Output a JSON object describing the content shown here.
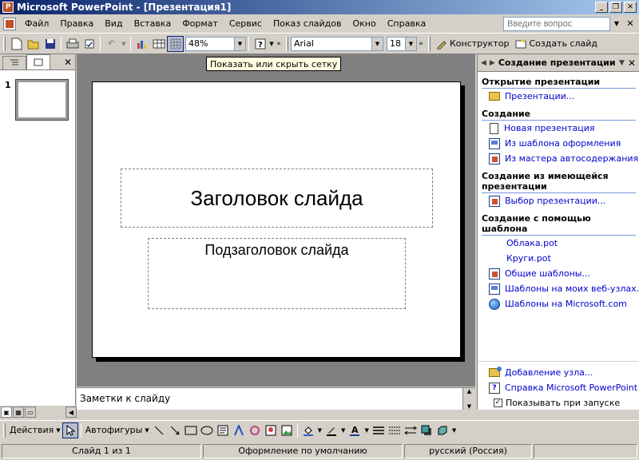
{
  "window": {
    "title": "Microsoft PowerPoint - [Презентация1]",
    "minimize": "_",
    "restore": "❐",
    "close": "✕"
  },
  "menu": {
    "items": [
      "Файл",
      "Правка",
      "Вид",
      "Вставка",
      "Формат",
      "Сервис",
      "Показ слайдов",
      "Окно",
      "Справка"
    ],
    "ask_placeholder": "Введите вопрос",
    "doc_close": "✕"
  },
  "toolbar": {
    "zoom": "48%",
    "font": "Arial",
    "font_size": "18",
    "design_label": "Конструктор",
    "new_slide_label": "Создать слайд"
  },
  "tooltip": "Показать или скрыть сетку",
  "outline": {
    "slide_number": "1"
  },
  "slide": {
    "title": "Заголовок слайда",
    "subtitle": "Подзаголовок слайда"
  },
  "notes": {
    "placeholder": "Заметки к слайду"
  },
  "taskpane": {
    "title": "Создание презентации",
    "sections": [
      {
        "heading": "Открытие презентации",
        "links": [
          {
            "label": "Презентации...",
            "icon": "folder-icon"
          }
        ]
      },
      {
        "heading": "Создание",
        "links": [
          {
            "label": "Новая презентация",
            "icon": "document-icon"
          },
          {
            "label": "Из шаблона оформления",
            "icon": "template-icon"
          },
          {
            "label": "Из мастера автосодержания",
            "icon": "wizard-icon"
          }
        ]
      },
      {
        "heading": "Создание из имеющейся презентации",
        "links": [
          {
            "label": "Выбор презентации...",
            "icon": "wizard-icon"
          }
        ]
      },
      {
        "heading": "Создание с помощью шаблона",
        "links": [
          {
            "label": "Облака.pot",
            "icon": ""
          },
          {
            "label": "Круги.pot",
            "icon": ""
          },
          {
            "label": "Общие шаблоны...",
            "icon": "wizard-icon"
          },
          {
            "label": "Шаблоны на моих веб-узлах...",
            "icon": "template-icon"
          },
          {
            "label": "Шаблоны на Microsoft.com",
            "icon": "globe-icon"
          }
        ]
      }
    ],
    "bottom": {
      "add_site": "Добавление узла...",
      "help": "Справка Microsoft PowerPoint",
      "show_on_startup": "Показывать при запуске"
    }
  },
  "drawing": {
    "actions": "Действия",
    "autoshapes": "Автофигуры"
  },
  "status": {
    "slide": "Слайд 1 из 1",
    "design": "Оформление по умолчанию",
    "language": "русский (Россия)"
  }
}
